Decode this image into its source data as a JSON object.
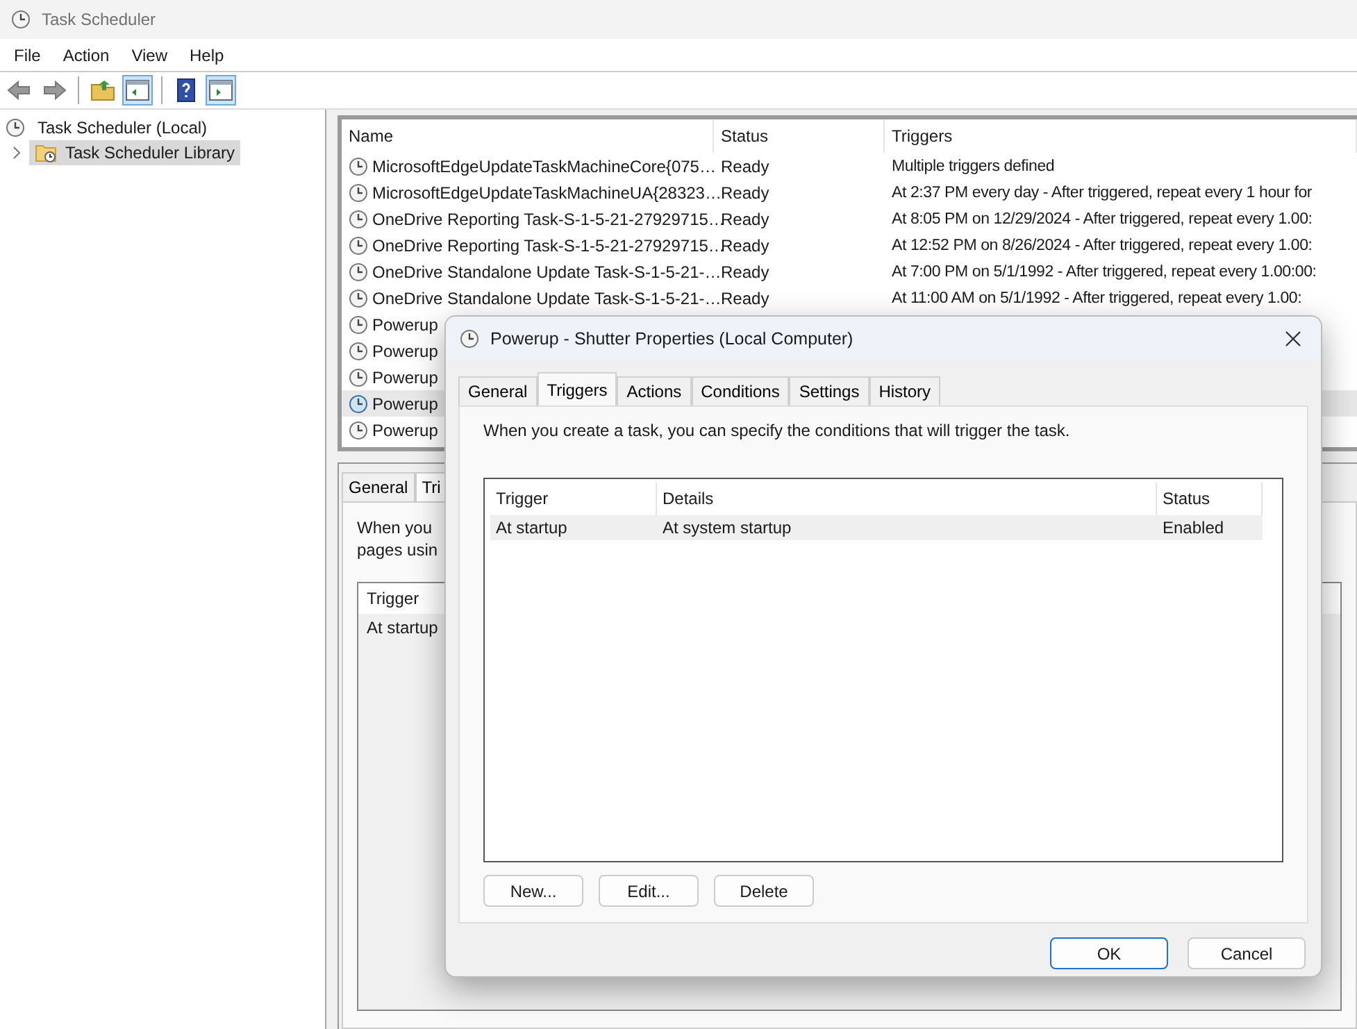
{
  "window": {
    "title": "Task Scheduler"
  },
  "menu": [
    "File",
    "Action",
    "View",
    "Help"
  ],
  "toolbar": [
    [
      {
        "kind": "back",
        "on": false
      },
      {
        "kind": "forward",
        "on": false
      }
    ],
    [
      {
        "kind": "folder-up",
        "on": false
      },
      {
        "kind": "pane-left",
        "on": true
      }
    ],
    [
      {
        "kind": "help",
        "on": false
      },
      {
        "kind": "pane-right",
        "on": true
      }
    ]
  ],
  "tree": [
    {
      "label": "Task Scheduler (Local)",
      "selected": false,
      "children": [
        {
          "label": "Task Scheduler Library",
          "selected": true,
          "expanded": false
        }
      ]
    }
  ],
  "task_list": {
    "columns": [
      "Name",
      "Status",
      "Triggers"
    ],
    "rows": [
      {
        "name": "MicrosoftEdgeUpdateTaskMachineCore{075…",
        "status": "Ready",
        "triggers": "Multiple triggers defined",
        "selected": false
      },
      {
        "name": "MicrosoftEdgeUpdateTaskMachineUA{28323…",
        "status": "Ready",
        "triggers": "At 2:37 PM every day - After triggered, repeat every 1 hour for",
        "selected": false
      },
      {
        "name": "OneDrive Reporting Task-S-1-5-21-27929715…",
        "status": "Ready",
        "triggers": "At 8:05 PM on 12/29/2024 - After triggered, repeat every 1.00:",
        "selected": false
      },
      {
        "name": "OneDrive Reporting Task-S-1-5-21-27929715…",
        "status": "Ready",
        "triggers": "At 12:52 PM on 8/26/2024 - After triggered, repeat every 1.00:",
        "selected": false
      },
      {
        "name": "OneDrive Standalone Update Task-S-1-5-21-…",
        "status": "Ready",
        "triggers": "At 7:00 PM on 5/1/1992 - After triggered, repeat every 1.00:00:",
        "selected": false
      },
      {
        "name": "OneDrive Standalone Update Task-S-1-5-21-…",
        "status": "Ready",
        "triggers": "At 11:00 AM on 5/1/1992 - After triggered, repeat every 1.00:",
        "selected": false
      },
      {
        "name": "Powerup",
        "selected": false
      },
      {
        "name": "Powerup",
        "selected": false
      },
      {
        "name": "Powerup",
        "selected": false
      },
      {
        "name": "Powerup",
        "selected": true
      },
      {
        "name": "Powerup",
        "selected": false
      }
    ]
  },
  "detail_pane": {
    "tabs": [
      {
        "label": "General",
        "selected": false
      },
      {
        "label": "Tri",
        "selected": true
      }
    ],
    "description": [
      "When you",
      "pages usin"
    ],
    "table": {
      "columns": [
        "Trigger"
      ],
      "rows": [
        [
          "At startup"
        ]
      ]
    }
  },
  "dialog": {
    "title": "Powerup - Shutter Properties (Local Computer)",
    "tabs": [
      {
        "label": "General",
        "selected": false
      },
      {
        "label": "Triggers",
        "selected": true
      },
      {
        "label": "Actions",
        "selected": false
      },
      {
        "label": "Conditions",
        "selected": false
      },
      {
        "label": "Settings",
        "selected": false
      },
      {
        "label": "History",
        "selected": false
      }
    ],
    "description": "When you create a task, you can specify the conditions that will trigger the task.",
    "table": {
      "columns": [
        "Trigger",
        "Details",
        "Status"
      ],
      "rows": [
        {
          "cells": [
            "At startup",
            "At system startup",
            "Enabled"
          ],
          "selected": true
        }
      ]
    },
    "buttons": [
      "New...",
      "Edit...",
      "Delete"
    ],
    "footer_buttons": [
      {
        "label": "OK",
        "default": true
      },
      {
        "label": "Cancel",
        "default": false
      }
    ]
  }
}
